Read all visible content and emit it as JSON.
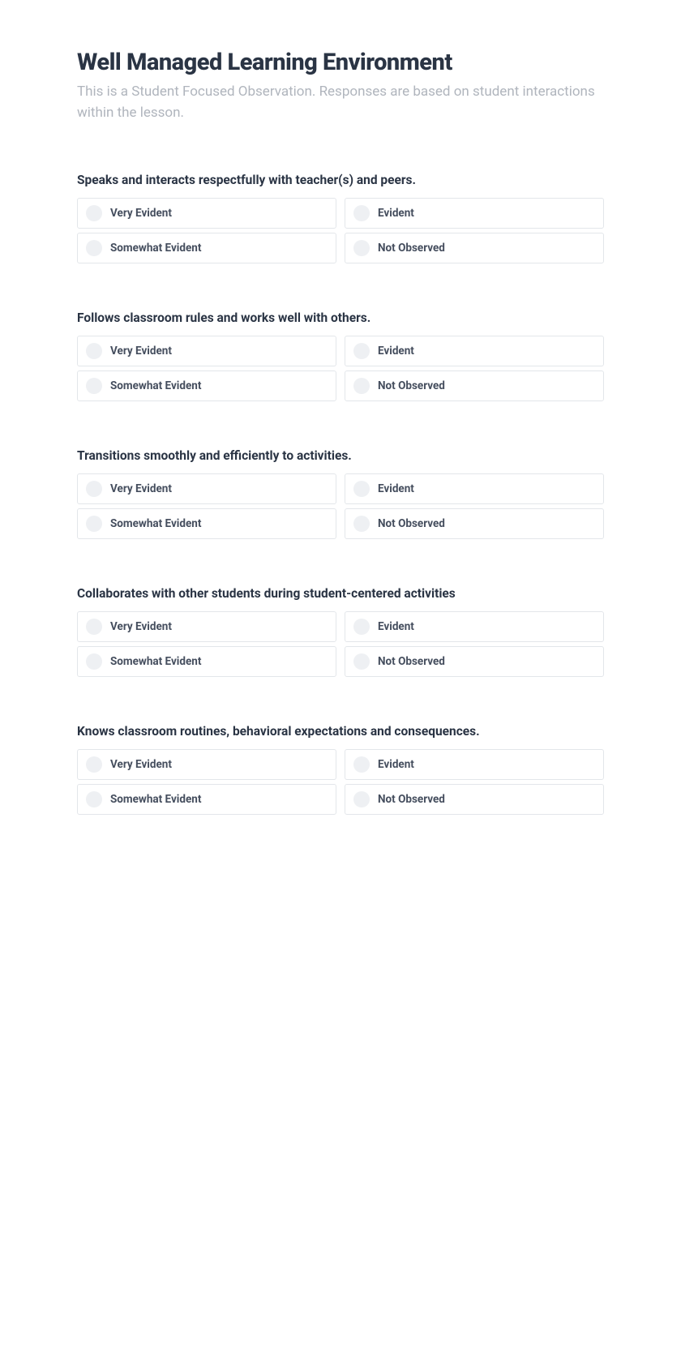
{
  "header": {
    "title": "Well Managed Learning Environment",
    "subtitle": "This is a Student Focused Observation. Responses are based on student interactions within the lesson."
  },
  "questions": [
    {
      "text": "Speaks and interacts respectfully with teacher(s) and peers.",
      "options": [
        "Very Evident",
        "Evident",
        "Somewhat Evident",
        "Not Observed"
      ]
    },
    {
      "text": "Follows classroom rules and works well with others.",
      "options": [
        "Very Evident",
        "Evident",
        "Somewhat Evident",
        "Not Observed"
      ]
    },
    {
      "text": "Transitions smoothly and efficiently to activities.",
      "options": [
        "Very Evident",
        "Evident",
        "Somewhat Evident",
        "Not Observed"
      ]
    },
    {
      "text": "Collaborates with other students during student-centered activities",
      "options": [
        "Very Evident",
        "Evident",
        "Somewhat Evident",
        "Not Observed"
      ]
    },
    {
      "text": "Knows classroom routines, behavioral expectations and consequences.",
      "options": [
        "Very Evident",
        "Evident",
        "Somewhat Evident",
        "Not Observed"
      ]
    }
  ]
}
